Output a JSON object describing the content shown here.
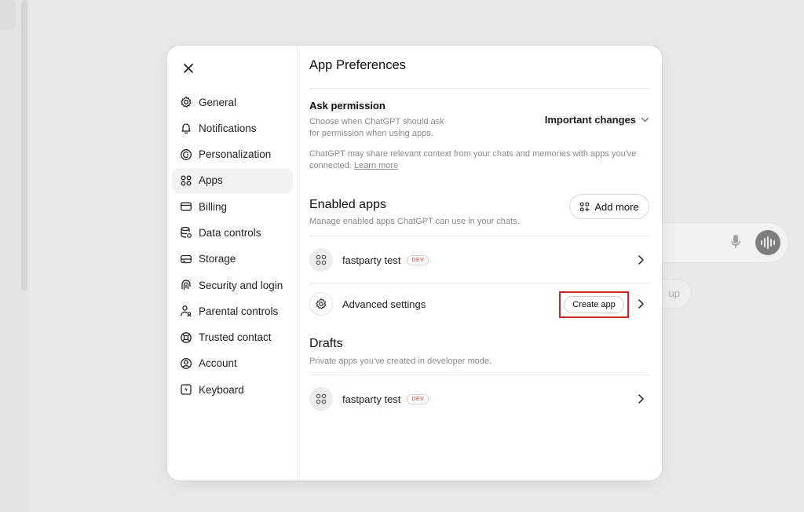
{
  "background": {
    "pill_label": "up"
  },
  "modal": {
    "page_title": "App Preferences",
    "nav": [
      {
        "label": "General",
        "icon": "gear-icon"
      },
      {
        "label": "Notifications",
        "icon": "bell-icon"
      },
      {
        "label": "Personalization",
        "icon": "personalization-icon"
      },
      {
        "label": "Apps",
        "icon": "apps-grid-icon",
        "active": true
      },
      {
        "label": "Billing",
        "icon": "credit-card-icon"
      },
      {
        "label": "Data controls",
        "icon": "database-icon"
      },
      {
        "label": "Storage",
        "icon": "storage-icon"
      },
      {
        "label": "Security and login",
        "icon": "fingerprint-icon"
      },
      {
        "label": "Parental controls",
        "icon": "parental-icon"
      },
      {
        "label": "Trusted contact",
        "icon": "lifebuoy-icon"
      },
      {
        "label": "Account",
        "icon": "user-circle-icon"
      },
      {
        "label": "Keyboard",
        "icon": "keyboard-icon"
      }
    ],
    "ask_permission": {
      "title": "Ask permission",
      "description": "Choose when ChatGPT should ask for permission when using apps.",
      "selected": "Important changes",
      "note": "ChatGPT may share relevant context from your chats and memories with apps you've connected.",
      "learn_more": "Learn more"
    },
    "enabled_apps": {
      "title": "Enabled apps",
      "description": "Manage enabled apps ChatGPT can use in your chats.",
      "add_more": "Add more",
      "items": [
        {
          "name": "fastparty test",
          "badge": "DEV"
        }
      ],
      "advanced": {
        "label": "Advanced settings",
        "create_app": "Create app"
      }
    },
    "drafts": {
      "title": "Drafts",
      "description": "Private apps you've created in developer mode.",
      "items": [
        {
          "name": "fastparty test",
          "badge": "DEV"
        }
      ]
    }
  },
  "colors": {
    "accent_highlight": "#d2202e",
    "dev_badge": "#d23b2f",
    "active_nav": "#f2f2f2"
  }
}
